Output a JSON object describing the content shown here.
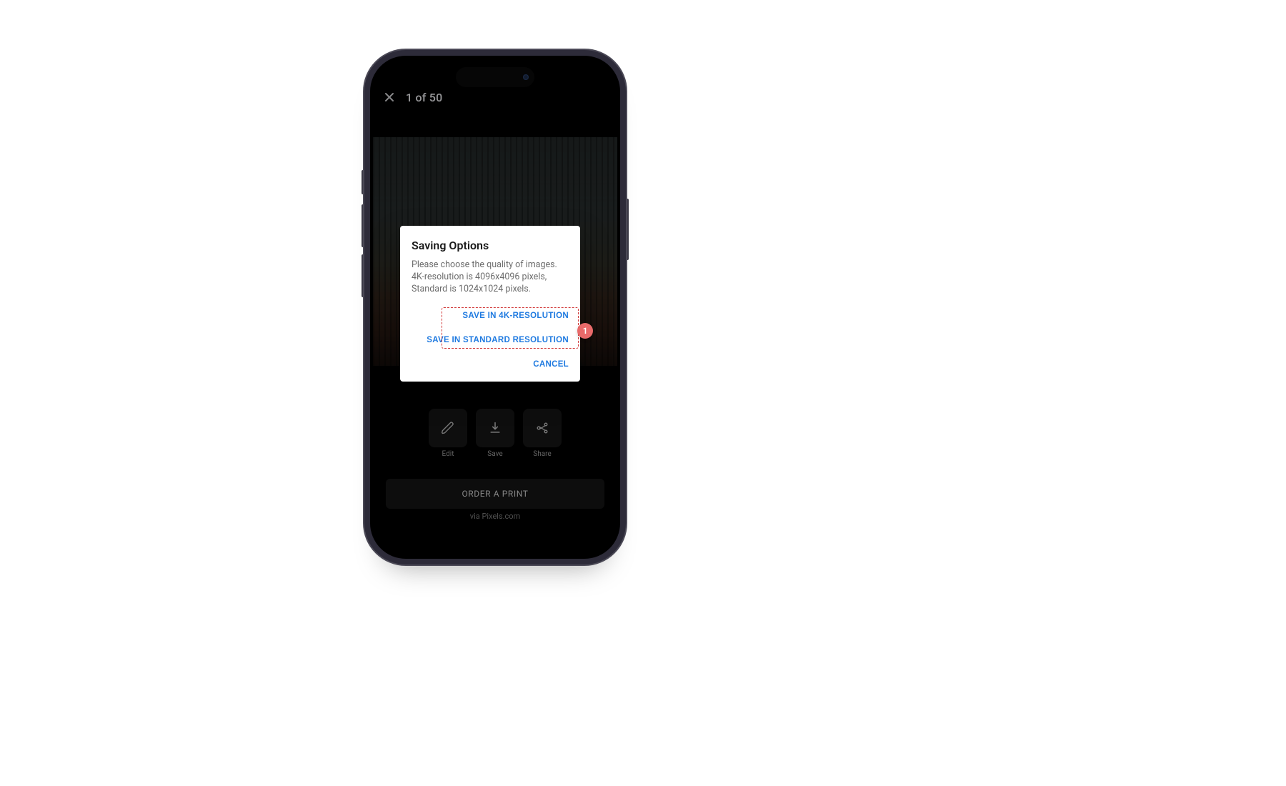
{
  "topbar": {
    "counter": "1 of 50"
  },
  "modal": {
    "title": "Saving Options",
    "body": "Please choose the quality of images.\n4K-resolution is 4096x4096 pixels,\nStandard is 1024x1024 pixels.",
    "save4k": "SAVE IN 4K-RESOLUTION",
    "saveStd": "SAVE IN STANDARD RESOLUTION",
    "cancel": "CANCEL"
  },
  "tiles": {
    "edit": "Edit",
    "save": "Save",
    "share": "Share"
  },
  "order": {
    "button": "ORDER A PRINT",
    "via": "via Pixels.com"
  },
  "callout": {
    "badge": "1"
  }
}
